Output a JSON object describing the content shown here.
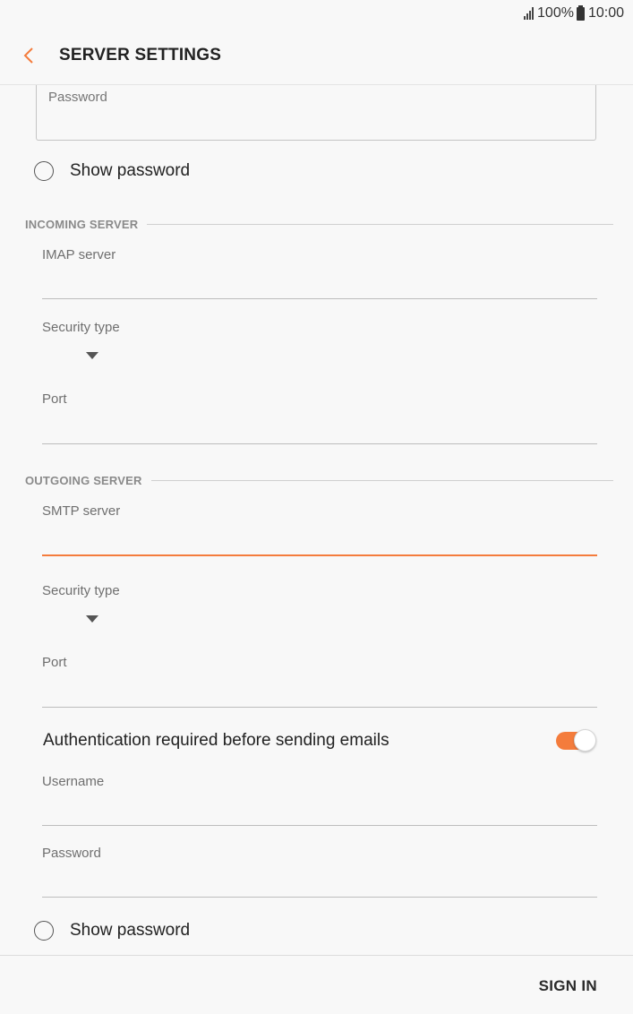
{
  "status_bar": {
    "battery": "100%",
    "time": "10:00"
  },
  "header": {
    "title": "SERVER SETTINGS"
  },
  "account": {
    "password_label": "Password",
    "show_password_label": "Show password"
  },
  "incoming": {
    "section_title": "INCOMING SERVER",
    "server_label": "IMAP server",
    "security_label": "Security type",
    "port_label": "Port"
  },
  "outgoing": {
    "section_title": "OUTGOING SERVER",
    "server_label": "SMTP server",
    "security_label": "Security type",
    "port_label": "Port",
    "auth_label": "Authentication required before sending emails",
    "auth_enabled": true,
    "username_label": "Username",
    "password_label": "Password",
    "show_password_label": "Show password"
  },
  "footer": {
    "sign_in_label": "SIGN IN"
  },
  "colors": {
    "accent": "#f47c3c",
    "background": "#f8f8f8"
  }
}
